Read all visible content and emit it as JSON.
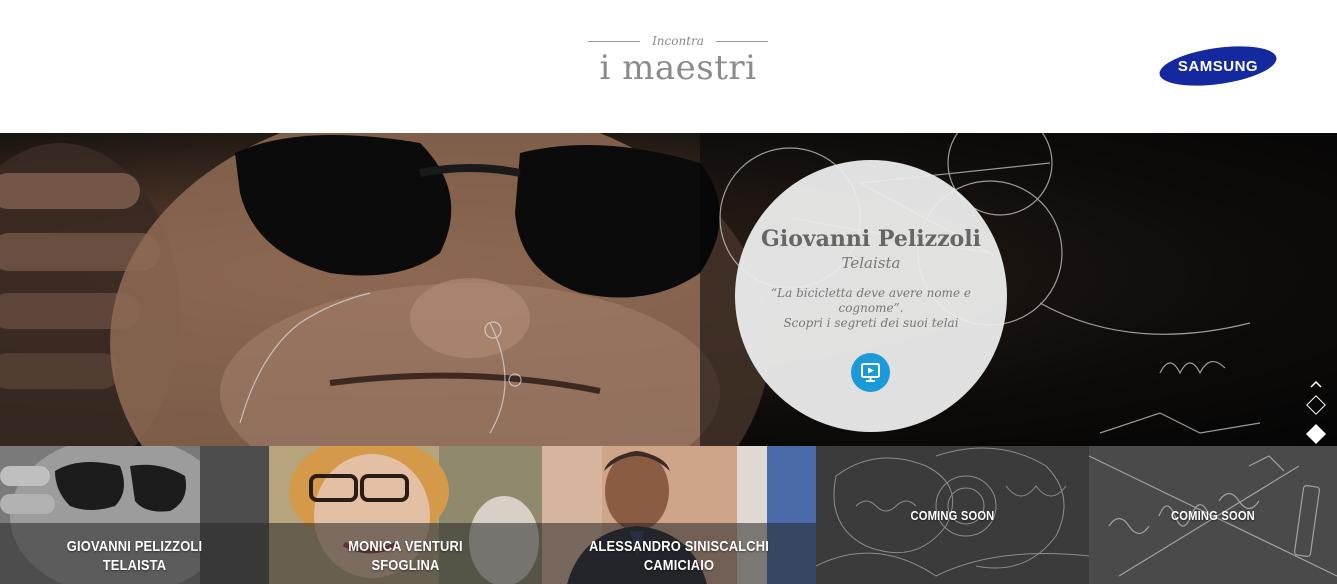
{
  "header": {
    "kicker": "Incontra",
    "title": "i maestri",
    "logo_text": "SAMSUNG"
  },
  "hero": {
    "name": "Giovanni Pelizzoli",
    "role": "Telaista",
    "quote": "“La bicicletta deve avere nome e cognome”.",
    "cta": "Scopri i segreti dei suoi telai",
    "play_icon": "play-screen-icon",
    "nav": {
      "current_slide": 2,
      "total_slides": 3
    }
  },
  "tiles": [
    {
      "name": "GIOVANNI PELIZZOLI",
      "role": "TELAISTA"
    },
    {
      "name": "MONICA VENTURI",
      "role": "SFOGLINA"
    },
    {
      "name": "ALESSANDRO SINISCALCHI",
      "role": "CAMICIAIO"
    },
    {
      "coming": "COMING SOON"
    },
    {
      "coming": "COMING SOON"
    }
  ],
  "colors": {
    "accent": "#1a9ad8",
    "samsung_blue": "#1428a0"
  }
}
